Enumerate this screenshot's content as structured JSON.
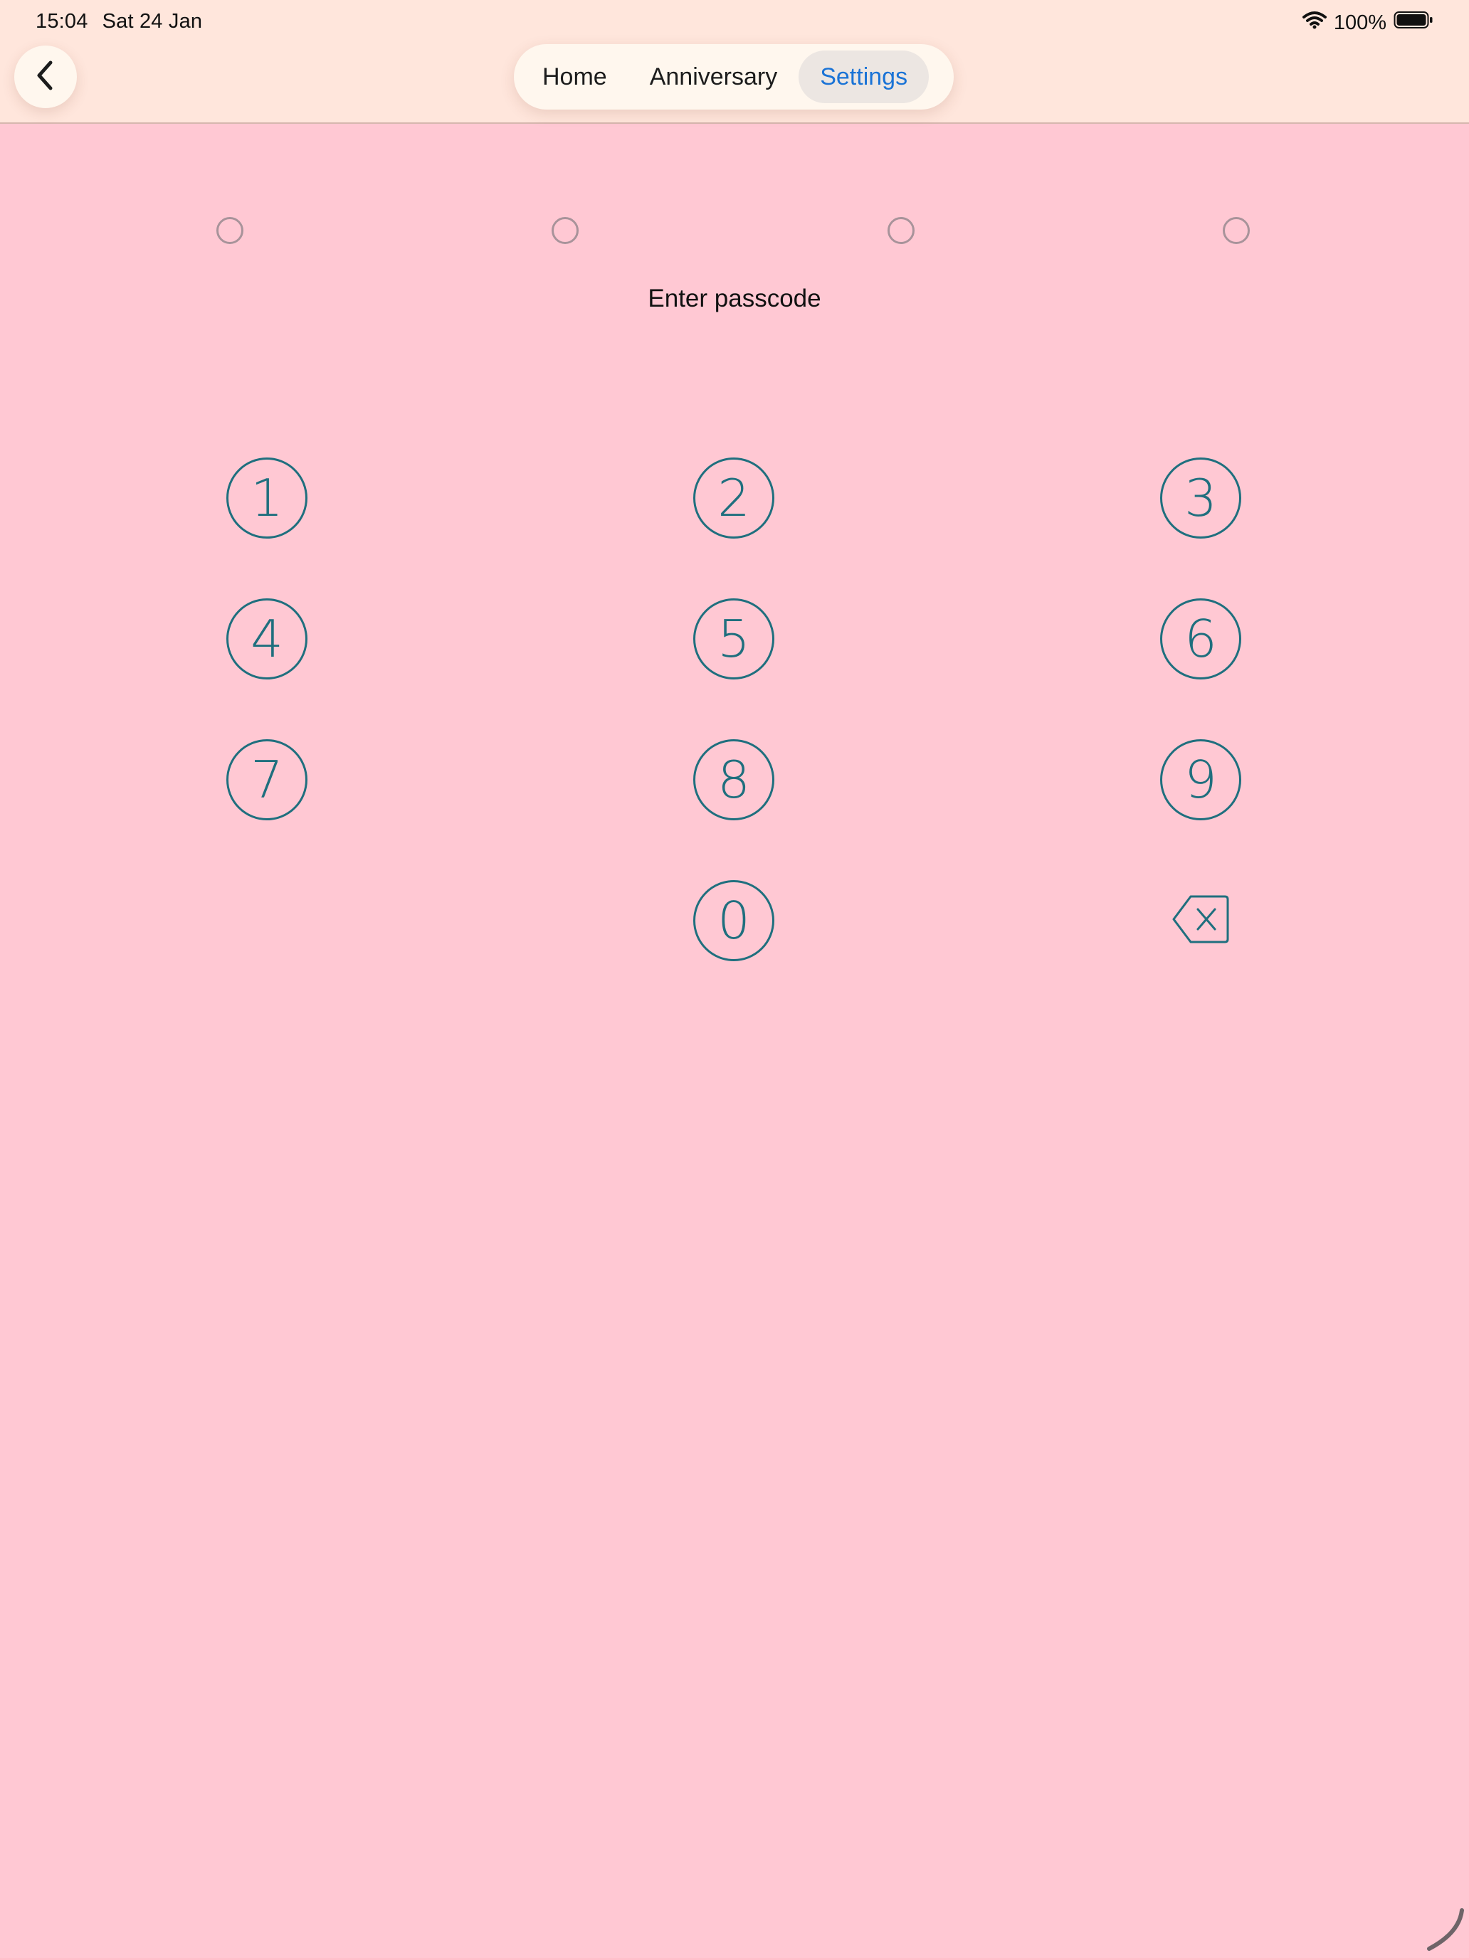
{
  "status_bar": {
    "time": "15:04",
    "date": "Sat 24 Jan",
    "battery": "100%",
    "icons": [
      "wifi-icon",
      "battery-icon"
    ]
  },
  "nav": {
    "back_icon": "chevron-left-icon",
    "tabs": [
      {
        "label": "Home",
        "active": false
      },
      {
        "label": "Anniversary",
        "active": false
      },
      {
        "label": "Settings",
        "active": true
      }
    ]
  },
  "passcode": {
    "prompt": "Enter passcode",
    "digits_total": 4,
    "digits_entered": 0
  },
  "keypad": {
    "keys": [
      "1",
      "2",
      "3",
      "4",
      "5",
      "6",
      "7",
      "8",
      "9",
      "0"
    ],
    "delete_icon": "delete-backspace-icon"
  },
  "colors": {
    "background": "#FFC8D3",
    "header": "#FFE6DC",
    "accent": "#1F6F7E",
    "active_tab_text": "#1A73D6"
  }
}
